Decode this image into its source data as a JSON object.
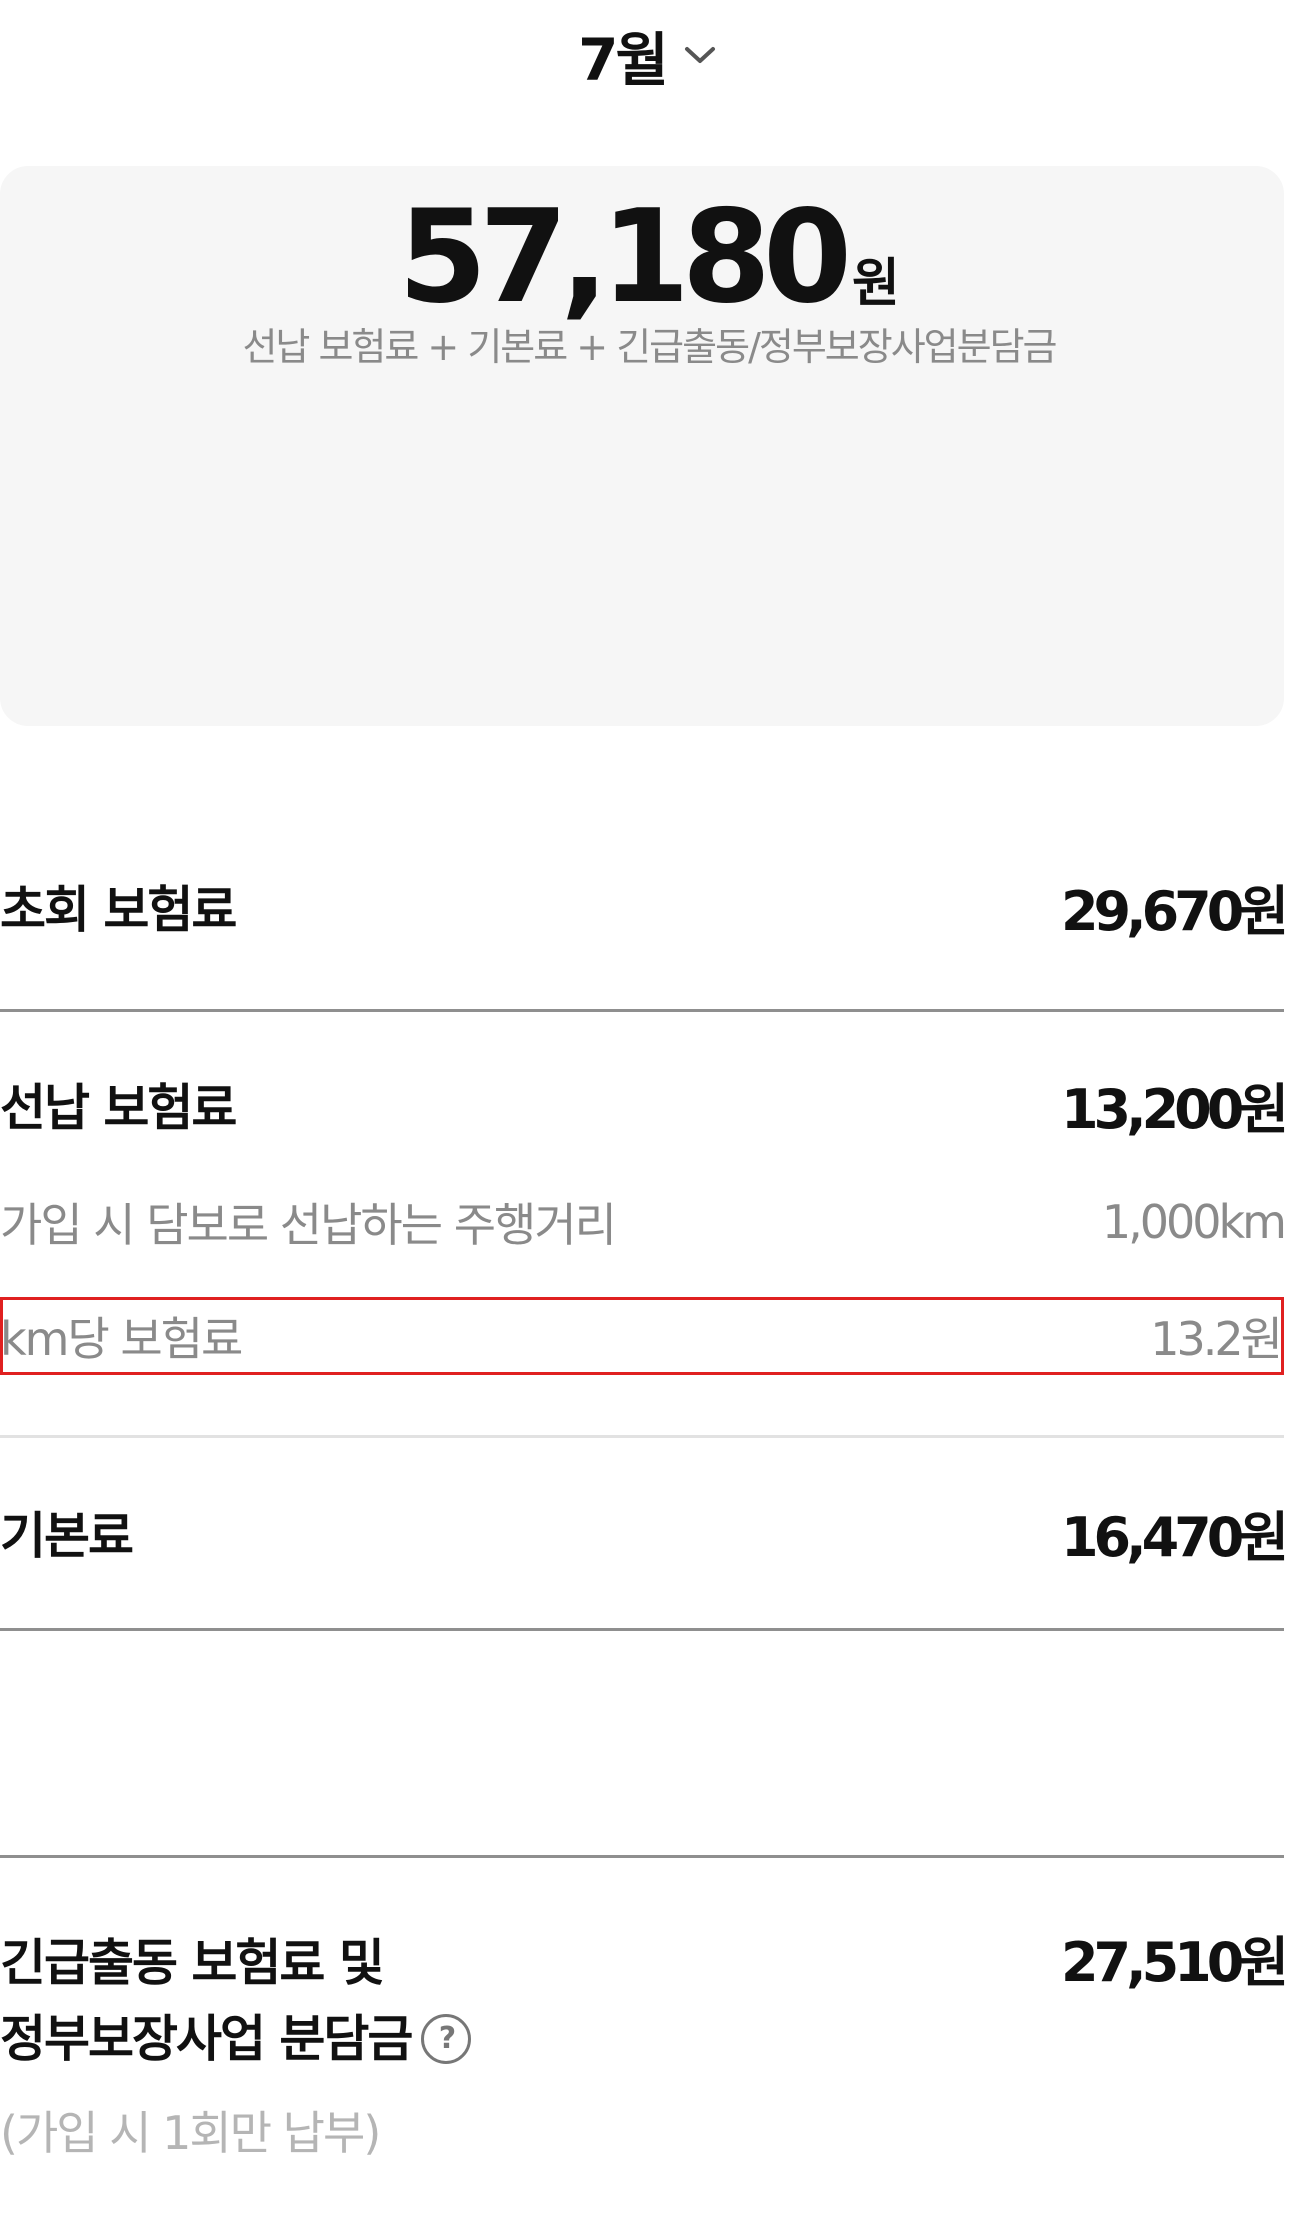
{
  "month_selector": {
    "label": "7월"
  },
  "summary": {
    "amount": "57,180",
    "unit": "원",
    "subtitle": "선납 보험료 + 기본료 + 긴급출동/정부보장사업분담금"
  },
  "initial_premium": {
    "title": "초회 보험료",
    "value": "29,670원"
  },
  "prepaid_premium": {
    "title": "선납 보험료",
    "value": "13,200원",
    "details": [
      {
        "label": "가입 시 담보로 선납하는 주행거리",
        "value": "1,000km"
      },
      {
        "label": "km당 보험료",
        "value": "13.2원"
      }
    ]
  },
  "base_fee": {
    "title": "기본료",
    "value": "16,470원"
  },
  "emergency": {
    "title_line1": "긴급출동 보험료 및",
    "title_line2": "정부보장사업 분담금",
    "help_icon": "?",
    "value": "27,510원",
    "note": "(가입 시 1회만 납부)"
  },
  "icons": {
    "chevron": "chevron-down-icon",
    "help": "question-circle-icon"
  },
  "colors": {
    "highlight_border": "#e02020",
    "card_background": "#f6f6f6",
    "muted_text": "#8a8a8a"
  }
}
